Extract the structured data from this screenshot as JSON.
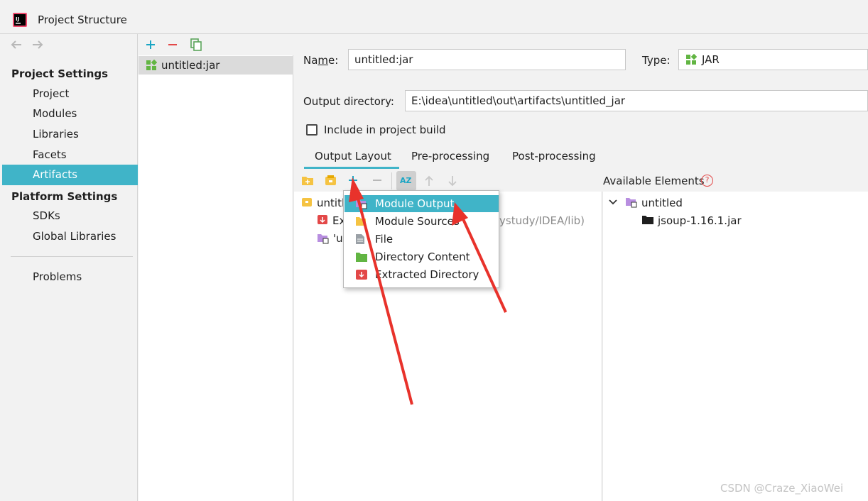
{
  "window": {
    "title": "Project Structure"
  },
  "nav": {
    "project_settings_header": "Project Settings",
    "project_items": [
      "Project",
      "Modules",
      "Libraries",
      "Facets",
      "Artifacts"
    ],
    "selected_item": "Artifacts",
    "platform_settings_header": "Platform Settings",
    "platform_items": [
      "SDKs",
      "Global Libraries"
    ],
    "problems": "Problems"
  },
  "artifacts": {
    "items": [
      "untitled:jar"
    ]
  },
  "form": {
    "name_label_pre": "Na",
    "name_label_mnemonic": "m",
    "name_label_post": "e:",
    "name_value": "untitled:jar",
    "type_label": "Type:",
    "type_value": "JAR",
    "output_dir_label": "Output directory:",
    "output_dir_value": "E:\\idea\\untitled\\out\\artifacts\\untitled_jar",
    "include_build_label": "Include in project build",
    "include_build_checked": false
  },
  "tabs": [
    "Output Layout",
    "Pre-processing",
    "Post-processing"
  ],
  "active_tab": "Output Layout",
  "output_layout": {
    "rows": [
      {
        "text": "untitl",
        "icon": "jar-folder-icon"
      },
      {
        "text": "Ex",
        "icon": "extracted-dir-icon"
      },
      {
        "text": "'u",
        "icon": "module-output-icon"
      }
    ],
    "partial_path": "ystudy/IDEA/lib)"
  },
  "available_elements": {
    "header": "Available Elements",
    "help": "?",
    "tree": [
      {
        "text": "untitled",
        "expanded": true
      },
      {
        "text": "jsoup-1.16.1.jar"
      }
    ]
  },
  "popup_menu": {
    "items": [
      "Module Output",
      "Module Sources",
      "File",
      "Directory Content",
      "Extracted Directory"
    ],
    "active": "Module Output"
  },
  "toolbar_icons": {
    "artifact_list": [
      "add-icon",
      "remove-icon",
      "copy-icon"
    ],
    "layout": [
      "new-directory-icon",
      "create-archive-icon",
      "add-icon",
      "remove-icon",
      "sort-az-icon",
      "move-up-icon",
      "move-down-icon"
    ],
    "sort_label": "AZ"
  },
  "colors": {
    "selection": "#40b4c8",
    "arrow": "#e8322b",
    "add": "#1aa5c4",
    "remove": "#e34848"
  },
  "watermark": "CSDN @Craze_XiaoWei"
}
